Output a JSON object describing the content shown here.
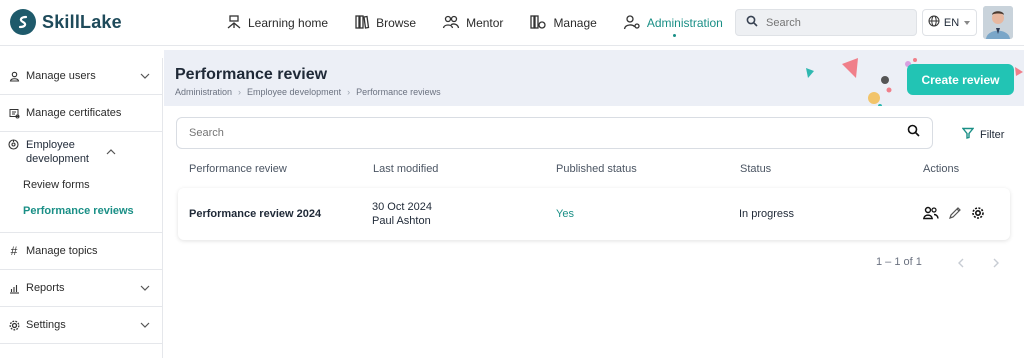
{
  "app": {
    "name": "SkillLake"
  },
  "nav": {
    "items": [
      {
        "label": "Learning home",
        "icon": "learning-home-icon"
      },
      {
        "label": "Browse",
        "icon": "books-icon"
      },
      {
        "label": "Mentor",
        "icon": "people-icon"
      },
      {
        "label": "Manage",
        "icon": "manage-icon"
      },
      {
        "label": "Administration",
        "icon": "admin-icon",
        "active": true
      }
    ],
    "search_placeholder": "Search",
    "language": "EN"
  },
  "sidebar": {
    "items": [
      {
        "label": "Manage users",
        "icon": "user-icon",
        "expandable": true
      },
      {
        "label": "Manage certificates",
        "icon": "certificate-icon",
        "expandable": false
      }
    ],
    "group": {
      "label": "Employee development",
      "icon": "development-icon",
      "children": [
        {
          "label": "Review forms",
          "active": false
        },
        {
          "label": "Performance reviews",
          "active": true
        }
      ]
    },
    "items_after": [
      {
        "label": "Manage topics",
        "icon": "hash-icon",
        "expandable": false
      },
      {
        "label": "Reports",
        "icon": "reports-icon",
        "expandable": true
      },
      {
        "label": "Settings",
        "icon": "gear-icon",
        "expandable": true
      }
    ]
  },
  "page": {
    "title": "Performance review",
    "breadcrumb": [
      "Administration",
      "Employee development",
      "Performance reviews"
    ],
    "create_label": "Create review",
    "search_placeholder": "Search",
    "filter_label": "Filter"
  },
  "table": {
    "columns": [
      "Performance review",
      "Last modified",
      "Published status",
      "Status",
      "Actions"
    ],
    "rows": [
      {
        "name": "Performance review 2024",
        "modified_date": "30 Oct 2024",
        "modified_by": "Paul Ashton",
        "published": "Yes",
        "status": "In progress"
      }
    ],
    "pagination": "1 – 1 of 1"
  },
  "colors": {
    "accent": "#1a8f86",
    "button": "#22c4b4",
    "banner": "#eceff6"
  }
}
